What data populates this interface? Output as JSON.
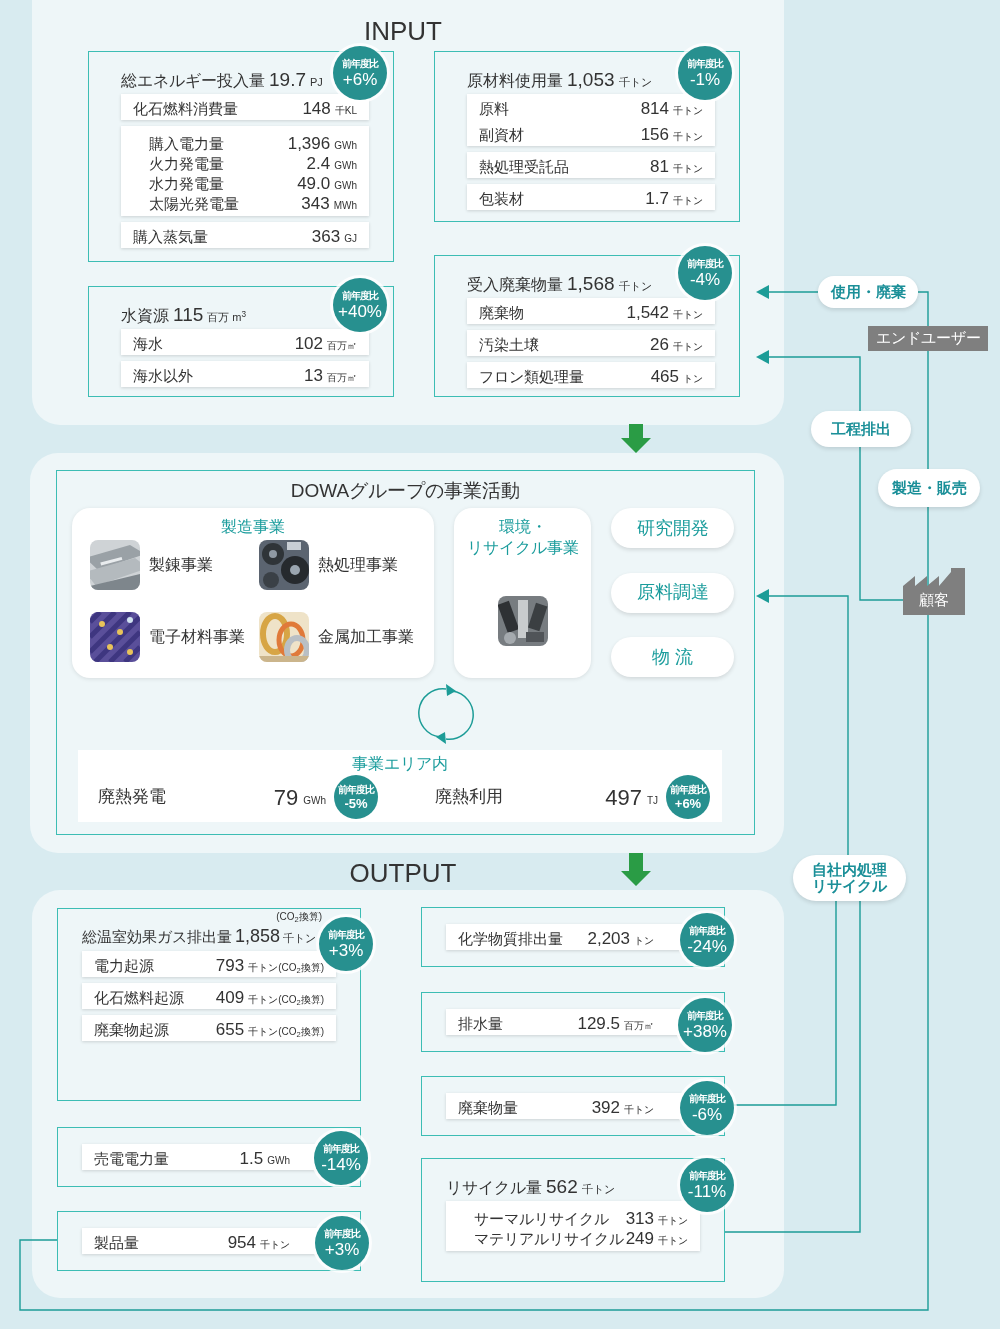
{
  "input": {
    "heading": "INPUT",
    "cards": [
      {
        "title": "総エネルギー投入量",
        "value": "19.7",
        "unit": "PJ",
        "badge": {
          "label": "前年度比",
          "change": "+6%"
        },
        "groups": [
          {
            "kind": "rows",
            "rows": [
              {
                "label": "化石燃料消費量",
                "value": "148",
                "unit": "千KL"
              }
            ]
          },
          {
            "kind": "list",
            "rows": [
              {
                "label": "購入電力量",
                "value": "1,396",
                "unit": "GWh"
              },
              {
                "label": "火力発電量",
                "value": "2.4",
                "unit": "GWh"
              },
              {
                "label": "水力発電量",
                "value": "49.0",
                "unit": "GWh"
              },
              {
                "label": "太陽光発電量",
                "value": "343",
                "unit": "MWh"
              }
            ]
          },
          {
            "kind": "rows",
            "rows": [
              {
                "label": "購入蒸気量",
                "value": "363",
                "unit": "GJ"
              }
            ]
          }
        ]
      },
      {
        "title": "水資源",
        "value": "115",
        "unit": "百万 m$^{3}$",
        "badge": {
          "label": "前年度比",
          "change": "+40%"
        },
        "groups": [
          {
            "kind": "rows",
            "rows": [
              {
                "label": "海水",
                "value": "102",
                "unit": "百万㎡"
              }
            ]
          },
          {
            "kind": "rows",
            "rows": [
              {
                "label": "海水以外",
                "value": "13",
                "unit": "百万㎡"
              }
            ]
          }
        ]
      },
      {
        "title": "原材料使用量",
        "value": "1,053",
        "unit": "千トン",
        "badge": {
          "label": "前年度比",
          "change": "-1%"
        },
        "groups": [
          {
            "kind": "rows",
            "rows": [
              {
                "label": "原料",
                "value": "814",
                "unit": "千トン"
              },
              {
                "label": "副資材",
                "value": "156",
                "unit": "千トン"
              }
            ]
          },
          {
            "kind": "rows",
            "rows": [
              {
                "label": "熱処理受託品",
                "value": "81",
                "unit": "千トン"
              }
            ]
          },
          {
            "kind": "rows",
            "rows": [
              {
                "label": "包装材",
                "value": "1.7",
                "unit": "千トン"
              }
            ]
          }
        ]
      },
      {
        "title": "受入廃棄物量",
        "value": "1,568",
        "unit": "千トン",
        "badge": {
          "label": "前年度比",
          "change": "-4%"
        },
        "groups": [
          {
            "kind": "rows",
            "rows": [
              {
                "label": "廃棄物",
                "value": "1,542",
                "unit": "千トン"
              }
            ]
          },
          {
            "kind": "rows",
            "rows": [
              {
                "label": "汚染土壌",
                "value": "26",
                "unit": "千トン"
              }
            ]
          },
          {
            "kind": "rows",
            "rows": [
              {
                "label": "フロン類処理量",
                "value": "465",
                "unit": "トン"
              }
            ]
          }
        ]
      }
    ]
  },
  "activities": {
    "heading": "DOWAグループの事業活動",
    "manufacturing": {
      "heading": "製造事業",
      "items": [
        "製錬事業",
        "熱処理事業",
        "電子材料事業",
        "金属加工事業"
      ]
    },
    "environment": {
      "heading_lines": [
        "環境・",
        "リサイクル事業"
      ]
    },
    "functions": [
      "研究開発",
      "原料調達",
      "物 流"
    ],
    "site": {
      "heading": "事業エリア内",
      "items": [
        {
          "label": "廃熱発電",
          "value": "79",
          "unit": "GWh",
          "badge": {
            "label": "前年度比",
            "change": "-5%"
          }
        },
        {
          "label": "廃熱利用",
          "value": "497",
          "unit": "TJ",
          "badge": {
            "label": "前年度比",
            "change": "+6%"
          }
        }
      ]
    }
  },
  "output": {
    "heading": "OUTPUT",
    "cards": [
      {
        "title": "総温室効果ガス排出量",
        "value": "1,858",
        "unit": "千トン",
        "note": "(CO$_{2}$換算)",
        "badge": {
          "label": "前年度比",
          "change": "+3%"
        },
        "groups": [
          {
            "kind": "rows",
            "rows": [
              {
                "label": "電力起源",
                "value": "793",
                "unit": "千トン(CO$_{2}$換算)"
              }
            ]
          },
          {
            "kind": "rows",
            "rows": [
              {
                "label": "化石燃料起源",
                "value": "409",
                "unit": "千トン(CO$_{2}$換算)"
              }
            ]
          },
          {
            "kind": "rows",
            "rows": [
              {
                "label": "廃棄物起源",
                "value": "655",
                "unit": "千トン(CO$_{2}$換算)"
              }
            ]
          }
        ]
      },
      {
        "badge": {
          "label": "前年度比",
          "change": "-14%"
        },
        "groups": [
          {
            "kind": "rows",
            "rows": [
              {
                "label": "売電電力量",
                "value": "1.5",
                "unit": "GWh"
              }
            ]
          }
        ]
      },
      {
        "badge": {
          "label": "前年度比",
          "change": "+3%"
        },
        "groups": [
          {
            "kind": "rows",
            "rows": [
              {
                "label": "製品量",
                "value": "954",
                "unit": "千トン"
              }
            ]
          }
        ]
      },
      {
        "badge": {
          "label": "前年度比",
          "change": "-24%"
        },
        "groups": [
          {
            "kind": "rows",
            "rows": [
              {
                "label": "化学物質排出量",
                "value": "2,203",
                "unit": "トン"
              }
            ]
          }
        ]
      },
      {
        "badge": {
          "label": "前年度比",
          "change": "+38%"
        },
        "groups": [
          {
            "kind": "rows",
            "rows": [
              {
                "label": "排水量",
                "value": "129.5",
                "unit": "百万㎡"
              }
            ]
          }
        ]
      },
      {
        "badge": {
          "label": "前年度比",
          "change": "-6%"
        },
        "groups": [
          {
            "kind": "rows",
            "rows": [
              {
                "label": "廃棄物量",
                "value": "392",
                "unit": "千トン"
              }
            ]
          }
        ]
      },
      {
        "title": "リサイクル量",
        "value": "562",
        "unit": "千トン",
        "badge": {
          "label": "前年度比",
          "change": "-11%"
        },
        "groups": [
          {
            "kind": "list",
            "rows": [
              {
                "label": "サーマルリサイクル",
                "value": "313",
                "unit": "千トン"
              },
              {
                "label": "マテリアルリサイクル",
                "value": "249",
                "unit": "千トン"
              }
            ]
          }
        ]
      }
    ]
  },
  "flows": [
    {
      "kind": "pill",
      "label": "使用・廃棄"
    },
    {
      "kind": "tag",
      "label": "エンドユーザー"
    },
    {
      "kind": "pill",
      "label": "工程排出"
    },
    {
      "kind": "pill",
      "label": "製造・販売"
    },
    {
      "kind": "factory",
      "label": "顧客"
    },
    {
      "kind": "pill",
      "lines": [
        "自社内処理",
        "リサイクル"
      ]
    }
  ]
}
